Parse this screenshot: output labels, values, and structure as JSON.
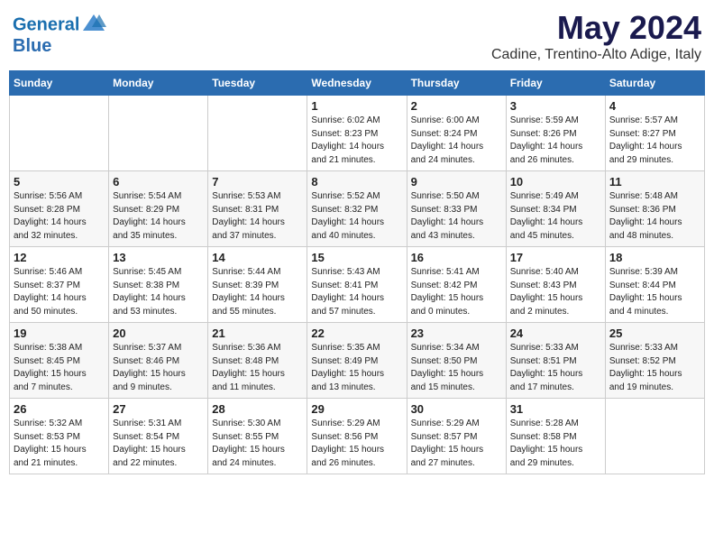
{
  "header": {
    "logo_line1": "General",
    "logo_line2": "Blue",
    "month_title": "May 2024",
    "location": "Cadine, Trentino-Alto Adige, Italy"
  },
  "days_of_week": [
    "Sunday",
    "Monday",
    "Tuesday",
    "Wednesday",
    "Thursday",
    "Friday",
    "Saturday"
  ],
  "weeks": [
    [
      {
        "day": "",
        "info": ""
      },
      {
        "day": "",
        "info": ""
      },
      {
        "day": "",
        "info": ""
      },
      {
        "day": "1",
        "info": "Sunrise: 6:02 AM\nSunset: 8:23 PM\nDaylight: 14 hours\nand 21 minutes."
      },
      {
        "day": "2",
        "info": "Sunrise: 6:00 AM\nSunset: 8:24 PM\nDaylight: 14 hours\nand 24 minutes."
      },
      {
        "day": "3",
        "info": "Sunrise: 5:59 AM\nSunset: 8:26 PM\nDaylight: 14 hours\nand 26 minutes."
      },
      {
        "day": "4",
        "info": "Sunrise: 5:57 AM\nSunset: 8:27 PM\nDaylight: 14 hours\nand 29 minutes."
      }
    ],
    [
      {
        "day": "5",
        "info": "Sunrise: 5:56 AM\nSunset: 8:28 PM\nDaylight: 14 hours\nand 32 minutes."
      },
      {
        "day": "6",
        "info": "Sunrise: 5:54 AM\nSunset: 8:29 PM\nDaylight: 14 hours\nand 35 minutes."
      },
      {
        "day": "7",
        "info": "Sunrise: 5:53 AM\nSunset: 8:31 PM\nDaylight: 14 hours\nand 37 minutes."
      },
      {
        "day": "8",
        "info": "Sunrise: 5:52 AM\nSunset: 8:32 PM\nDaylight: 14 hours\nand 40 minutes."
      },
      {
        "day": "9",
        "info": "Sunrise: 5:50 AM\nSunset: 8:33 PM\nDaylight: 14 hours\nand 43 minutes."
      },
      {
        "day": "10",
        "info": "Sunrise: 5:49 AM\nSunset: 8:34 PM\nDaylight: 14 hours\nand 45 minutes."
      },
      {
        "day": "11",
        "info": "Sunrise: 5:48 AM\nSunset: 8:36 PM\nDaylight: 14 hours\nand 48 minutes."
      }
    ],
    [
      {
        "day": "12",
        "info": "Sunrise: 5:46 AM\nSunset: 8:37 PM\nDaylight: 14 hours\nand 50 minutes."
      },
      {
        "day": "13",
        "info": "Sunrise: 5:45 AM\nSunset: 8:38 PM\nDaylight: 14 hours\nand 53 minutes."
      },
      {
        "day": "14",
        "info": "Sunrise: 5:44 AM\nSunset: 8:39 PM\nDaylight: 14 hours\nand 55 minutes."
      },
      {
        "day": "15",
        "info": "Sunrise: 5:43 AM\nSunset: 8:41 PM\nDaylight: 14 hours\nand 57 minutes."
      },
      {
        "day": "16",
        "info": "Sunrise: 5:41 AM\nSunset: 8:42 PM\nDaylight: 15 hours\nand 0 minutes."
      },
      {
        "day": "17",
        "info": "Sunrise: 5:40 AM\nSunset: 8:43 PM\nDaylight: 15 hours\nand 2 minutes."
      },
      {
        "day": "18",
        "info": "Sunrise: 5:39 AM\nSunset: 8:44 PM\nDaylight: 15 hours\nand 4 minutes."
      }
    ],
    [
      {
        "day": "19",
        "info": "Sunrise: 5:38 AM\nSunset: 8:45 PM\nDaylight: 15 hours\nand 7 minutes."
      },
      {
        "day": "20",
        "info": "Sunrise: 5:37 AM\nSunset: 8:46 PM\nDaylight: 15 hours\nand 9 minutes."
      },
      {
        "day": "21",
        "info": "Sunrise: 5:36 AM\nSunset: 8:48 PM\nDaylight: 15 hours\nand 11 minutes."
      },
      {
        "day": "22",
        "info": "Sunrise: 5:35 AM\nSunset: 8:49 PM\nDaylight: 15 hours\nand 13 minutes."
      },
      {
        "day": "23",
        "info": "Sunrise: 5:34 AM\nSunset: 8:50 PM\nDaylight: 15 hours\nand 15 minutes."
      },
      {
        "day": "24",
        "info": "Sunrise: 5:33 AM\nSunset: 8:51 PM\nDaylight: 15 hours\nand 17 minutes."
      },
      {
        "day": "25",
        "info": "Sunrise: 5:33 AM\nSunset: 8:52 PM\nDaylight: 15 hours\nand 19 minutes."
      }
    ],
    [
      {
        "day": "26",
        "info": "Sunrise: 5:32 AM\nSunset: 8:53 PM\nDaylight: 15 hours\nand 21 minutes."
      },
      {
        "day": "27",
        "info": "Sunrise: 5:31 AM\nSunset: 8:54 PM\nDaylight: 15 hours\nand 22 minutes."
      },
      {
        "day": "28",
        "info": "Sunrise: 5:30 AM\nSunset: 8:55 PM\nDaylight: 15 hours\nand 24 minutes."
      },
      {
        "day": "29",
        "info": "Sunrise: 5:29 AM\nSunset: 8:56 PM\nDaylight: 15 hours\nand 26 minutes."
      },
      {
        "day": "30",
        "info": "Sunrise: 5:29 AM\nSunset: 8:57 PM\nDaylight: 15 hours\nand 27 minutes."
      },
      {
        "day": "31",
        "info": "Sunrise: 5:28 AM\nSunset: 8:58 PM\nDaylight: 15 hours\nand 29 minutes."
      },
      {
        "day": "",
        "info": ""
      }
    ]
  ]
}
